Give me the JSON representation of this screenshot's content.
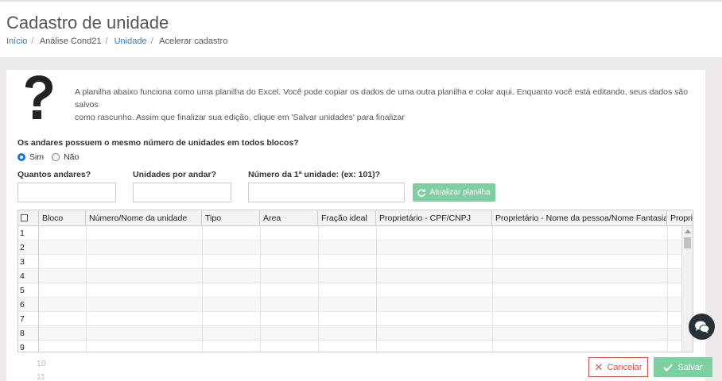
{
  "header": {
    "title": "Cadastro de unidade",
    "breadcrumb": [
      {
        "label": "Início",
        "link": true
      },
      {
        "label": "Análise Cond21",
        "link": false
      },
      {
        "label": "Unidade",
        "link": true
      },
      {
        "label": "Acelerar cadastro",
        "link": false
      }
    ]
  },
  "info": {
    "icon": "question-mark-icon",
    "line1": "A planilha abaixo funciona como uma planilha do Excel. Você pode copiar os dados de uma outra planilha e colar aqui. Enquanto você está editando, seus dados são salvos",
    "line2": "como rascunho. Assim que finalizar sua edição, clique em 'Salvar unidades' para finalizar"
  },
  "form": {
    "question": "Os andares possuem o mesmo número de unidades em todos blocos?",
    "option_yes": "Sim",
    "option_no": "Não",
    "selected": "Sim",
    "floors_label": "Quantos andares?",
    "floors_value": "",
    "units_label": "Unidades por andar?",
    "units_value": "",
    "first_unit_label": "Número da 1ª unidade: (ex: 101)?",
    "first_unit_value": "",
    "update_button": "Atualizar planilha"
  },
  "grid": {
    "columns": [
      "Bloco",
      "Número/Nome da unidade",
      "Tipo",
      "Area",
      "Fração ideal",
      "Proprietário - CPF/CNPJ",
      "Proprietário - Nome da pessoa/Nome Fantasia",
      "Propriet"
    ],
    "rows": [
      "1",
      "2",
      "3",
      "4",
      "5",
      "6",
      "7",
      "8",
      "9"
    ],
    "faded_rows": [
      "10",
      "11"
    ]
  },
  "actions": {
    "cancel": "Cancelar",
    "save": "Salvar"
  },
  "colors": {
    "accent_green": "#7dcfa1",
    "danger": "#d9534f",
    "link": "#337ab7"
  }
}
